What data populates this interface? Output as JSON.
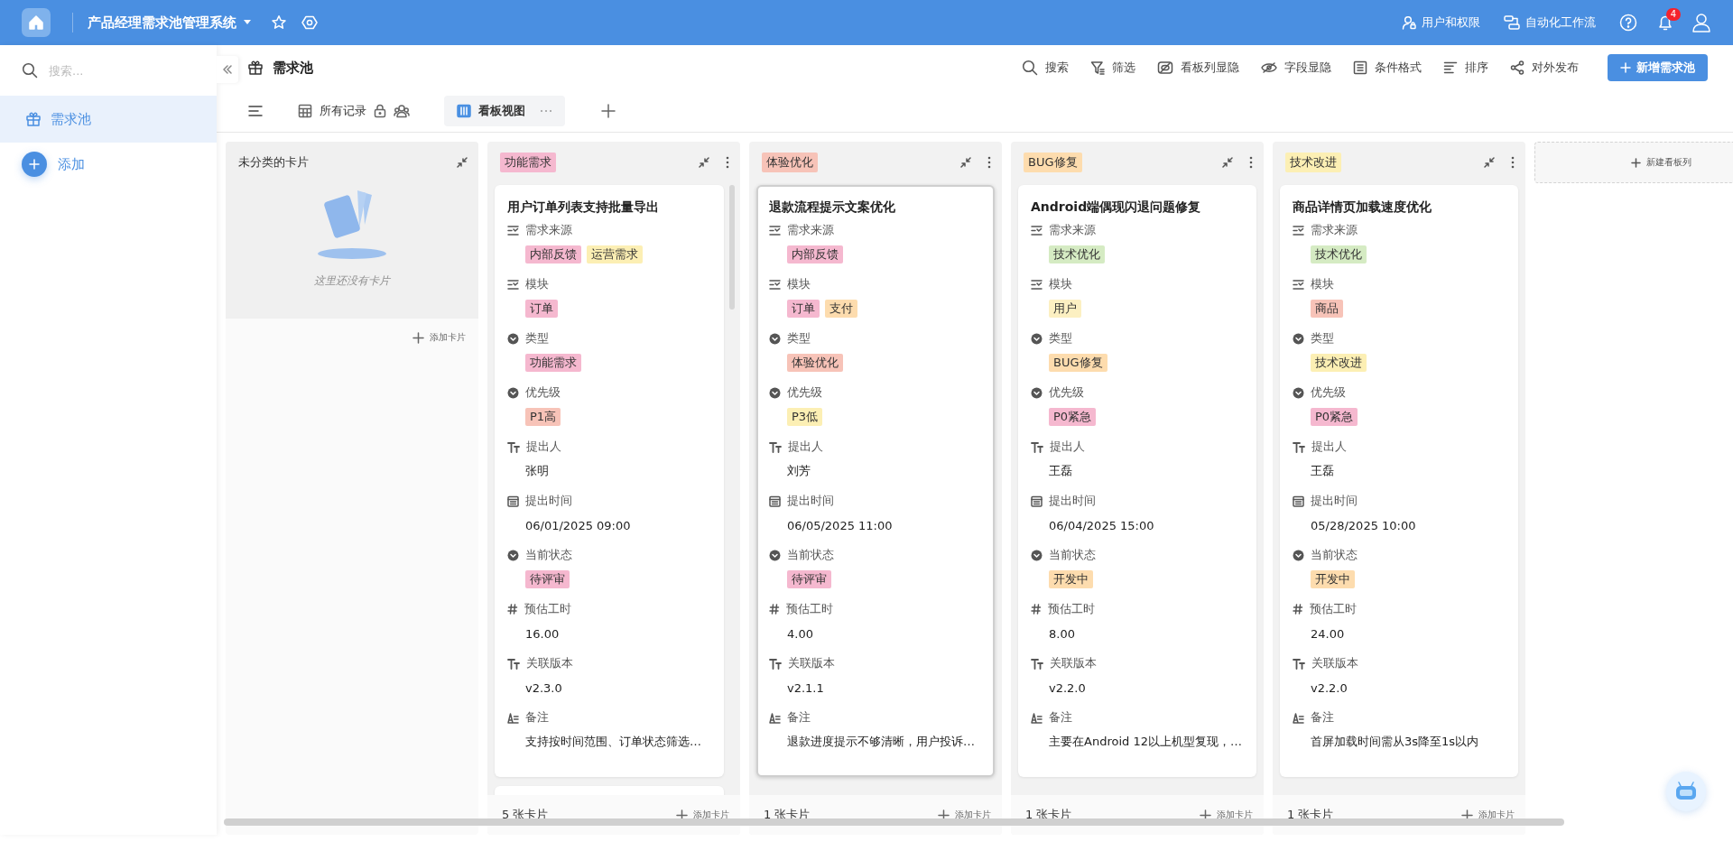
{
  "app": {
    "title": "产品经理需求池管理系统",
    "links": [
      {
        "label": "用户和权限"
      },
      {
        "label": "自动化工作流"
      }
    ],
    "notification_badge": "4"
  },
  "sidebar": {
    "search_placeholder": "搜索...",
    "items": [
      {
        "label": "需求池",
        "selected": true
      }
    ],
    "add_label": "添加"
  },
  "view": {
    "title": "需求池",
    "toolbar": [
      "搜索",
      "筛选",
      "看板列显隐",
      "字段显隐",
      "条件格式",
      "排序",
      "对外发布"
    ],
    "primary_button": "新增需求池",
    "tabs": [
      {
        "label": "所有记录",
        "selected": false
      },
      {
        "label": "看板视图",
        "selected": true
      }
    ]
  },
  "board": {
    "new_column_label": "新建看板列",
    "columns": [
      {
        "kind": "uncategorized",
        "title": "未分类的卡片",
        "empty_text": "这里还没有卡片",
        "add_label": "添加卡片"
      },
      {
        "kind": "group",
        "tag": {
          "label": "功能需求",
          "color": "#f5b8cf"
        },
        "count": "5 张卡片",
        "add_label": "添加卡片",
        "clipped_card": true,
        "cards": [
          {
            "selected": false,
            "title": "用户订单列表支持批量导出",
            "fields": [
              {
                "label": "需求来源",
                "kind": "multi_select",
                "tags": [
                  {
                    "label": "内部反馈",
                    "color": "#f5b8cf"
                  },
                  {
                    "label": "运营需求",
                    "color": "#fcefb4"
                  }
                ]
              },
              {
                "label": "模块",
                "kind": "multi_select",
                "tags": [
                  {
                    "label": "订单",
                    "color": "#f5b8cf"
                  }
                ]
              },
              {
                "label": "类型",
                "kind": "single_select",
                "tags": [
                  {
                    "label": "功能需求",
                    "color": "#f5b8cf"
                  }
                ]
              },
              {
                "label": "优先级",
                "kind": "single_select",
                "tags": [
                  {
                    "label": "P1高",
                    "color": "#f7c3b8"
                  }
                ]
              },
              {
                "label": "提出人",
                "kind": "text",
                "value": "张明"
              },
              {
                "label": "提出时间",
                "kind": "date",
                "value": "06/01/2025 09:00"
              },
              {
                "label": "当前状态",
                "kind": "single_select",
                "tags": [
                  {
                    "label": "待评审",
                    "color": "#f5b8cf"
                  }
                ]
              },
              {
                "label": "预估工时",
                "kind": "number",
                "value": "16.00"
              },
              {
                "label": "关联版本",
                "kind": "text",
                "value": "v2.3.0"
              },
              {
                "label": "备注",
                "kind": "long_text",
                "value": "支持按时间范围、订单状态筛选…"
              }
            ]
          }
        ]
      },
      {
        "kind": "group",
        "tag": {
          "label": "体验优化",
          "color": "#f7c3b8"
        },
        "count": "1 张卡片",
        "add_label": "添加卡片",
        "clipped_card": false,
        "cards": [
          {
            "selected": true,
            "title": "退款流程提示文案优化",
            "fields": [
              {
                "label": "需求来源",
                "kind": "multi_select",
                "tags": [
                  {
                    "label": "内部反馈",
                    "color": "#f5b8cf"
                  }
                ]
              },
              {
                "label": "模块",
                "kind": "multi_select",
                "tags": [
                  {
                    "label": "订单",
                    "color": "#f5b8cf"
                  },
                  {
                    "label": "支付",
                    "color": "#fddcae"
                  }
                ]
              },
              {
                "label": "类型",
                "kind": "single_select",
                "tags": [
                  {
                    "label": "体验优化",
                    "color": "#f7c3b8"
                  }
                ]
              },
              {
                "label": "优先级",
                "kind": "single_select",
                "tags": [
                  {
                    "label": "P3低",
                    "color": "#fcefb4"
                  }
                ]
              },
              {
                "label": "提出人",
                "kind": "text",
                "value": "刘芳"
              },
              {
                "label": "提出时间",
                "kind": "date",
                "value": "06/05/2025 11:00"
              },
              {
                "label": "当前状态",
                "kind": "single_select",
                "tags": [
                  {
                    "label": "待评审",
                    "color": "#f5b8cf"
                  }
                ]
              },
              {
                "label": "预估工时",
                "kind": "number",
                "value": "4.00"
              },
              {
                "label": "关联版本",
                "kind": "text",
                "value": "v2.1.1"
              },
              {
                "label": "备注",
                "kind": "long_text",
                "value": "退款进度提示不够清晰，用户投诉…"
              }
            ]
          }
        ]
      },
      {
        "kind": "group",
        "tag": {
          "label": "BUG修复",
          "color": "#fddcae"
        },
        "count": "1 张卡片",
        "add_label": "添加卡片",
        "clipped_card": false,
        "cards": [
          {
            "selected": false,
            "title": "Android端偶现闪退问题修复",
            "fields": [
              {
                "label": "需求来源",
                "kind": "multi_select",
                "tags": [
                  {
                    "label": "技术优化",
                    "color": "#d5ebc3"
                  }
                ]
              },
              {
                "label": "模块",
                "kind": "multi_select",
                "tags": [
                  {
                    "label": "用户",
                    "color": "#fcf0c2"
                  }
                ]
              },
              {
                "label": "类型",
                "kind": "single_select",
                "tags": [
                  {
                    "label": "BUG修复",
                    "color": "#fddcae"
                  }
                ]
              },
              {
                "label": "优先级",
                "kind": "single_select",
                "tags": [
                  {
                    "label": "P0紧急",
                    "color": "#f5b8cf"
                  }
                ]
              },
              {
                "label": "提出人",
                "kind": "text",
                "value": "王磊"
              },
              {
                "label": "提出时间",
                "kind": "date",
                "value": "06/04/2025 15:00"
              },
              {
                "label": "当前状态",
                "kind": "single_select",
                "tags": [
                  {
                    "label": "开发中",
                    "color": "#fddcae"
                  }
                ]
              },
              {
                "label": "预估工时",
                "kind": "number",
                "value": "8.00"
              },
              {
                "label": "关联版本",
                "kind": "text",
                "value": "v2.2.0"
              },
              {
                "label": "备注",
                "kind": "long_text",
                "value": "主要在Android 12以上机型复现，…"
              }
            ]
          }
        ]
      },
      {
        "kind": "group",
        "tag": {
          "label": "技术改进",
          "color": "#fcefb4"
        },
        "count": "1 张卡片",
        "add_label": "添加卡片",
        "clipped_card": false,
        "cards": [
          {
            "selected": false,
            "title": "商品详情页加载速度优化",
            "fields": [
              {
                "label": "需求来源",
                "kind": "multi_select",
                "tags": [
                  {
                    "label": "技术优化",
                    "color": "#d5ebc3"
                  }
                ]
              },
              {
                "label": "模块",
                "kind": "multi_select",
                "tags": [
                  {
                    "label": "商品",
                    "color": "#f7c3b8"
                  }
                ]
              },
              {
                "label": "类型",
                "kind": "single_select",
                "tags": [
                  {
                    "label": "技术改进",
                    "color": "#fcefb4"
                  }
                ]
              },
              {
                "label": "优先级",
                "kind": "single_select",
                "tags": [
                  {
                    "label": "P0紧急",
                    "color": "#f5b8cf"
                  }
                ]
              },
              {
                "label": "提出人",
                "kind": "text",
                "value": "王磊"
              },
              {
                "label": "提出时间",
                "kind": "date",
                "value": "05/28/2025 10:00"
              },
              {
                "label": "当前状态",
                "kind": "single_select",
                "tags": [
                  {
                    "label": "开发中",
                    "color": "#fddcae"
                  }
                ]
              },
              {
                "label": "预估工时",
                "kind": "number",
                "value": "24.00"
              },
              {
                "label": "关联版本",
                "kind": "text",
                "value": "v2.2.0"
              },
              {
                "label": "备注",
                "kind": "long_text",
                "value": "首屏加载时间需从3s降至1s以内"
              }
            ]
          }
        ]
      }
    ]
  }
}
